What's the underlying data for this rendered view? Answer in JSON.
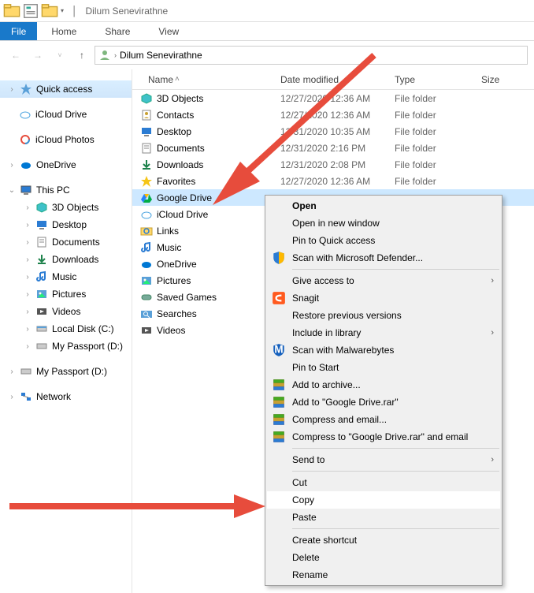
{
  "window": {
    "title": "Dilum Senevirathne"
  },
  "ribbon": {
    "file": "File",
    "tabs": [
      "Home",
      "Share",
      "View"
    ]
  },
  "breadcrumb": {
    "text": "Dilum Senevirathne"
  },
  "columns": {
    "name": "Name",
    "date": "Date modified",
    "type": "Type",
    "size": "Size"
  },
  "sidebar": {
    "quick_access": "Quick access",
    "icloud_drive": "iCloud Drive",
    "icloud_photos": "iCloud Photos",
    "onedrive": "OneDrive",
    "this_pc": "This PC",
    "pc_items": [
      "3D Objects",
      "Desktop",
      "Documents",
      "Downloads",
      "Music",
      "Pictures",
      "Videos",
      "Local Disk (C:)",
      "My Passport (D:)"
    ],
    "my_passport": "My Passport (D:)",
    "network": "Network"
  },
  "files": [
    {
      "name": "3D Objects",
      "date": "12/27/2020 12:36 AM",
      "type": "File folder",
      "icon": "3d"
    },
    {
      "name": "Contacts",
      "date": "12/27/2020 12:36 AM",
      "type": "File folder",
      "icon": "contacts"
    },
    {
      "name": "Desktop",
      "date": "12/31/2020 10:35 AM",
      "type": "File folder",
      "icon": "desktop"
    },
    {
      "name": "Documents",
      "date": "12/31/2020 2:16 PM",
      "type": "File folder",
      "icon": "docs"
    },
    {
      "name": "Downloads",
      "date": "12/31/2020 2:08 PM",
      "type": "File folder",
      "icon": "down"
    },
    {
      "name": "Favorites",
      "date": "12/27/2020 12:36 AM",
      "type": "File folder",
      "icon": "star"
    },
    {
      "name": "Google Drive",
      "date": "",
      "type": "",
      "icon": "gdrive",
      "selected": true
    },
    {
      "name": "iCloud Drive",
      "date": "",
      "type": "",
      "icon": "icloud"
    },
    {
      "name": "Links",
      "date": "",
      "type": "",
      "icon": "links"
    },
    {
      "name": "Music",
      "date": "",
      "type": "",
      "icon": "music"
    },
    {
      "name": "OneDrive",
      "date": "",
      "type": "",
      "icon": "onedrive"
    },
    {
      "name": "Pictures",
      "date": "",
      "type": "",
      "icon": "pics"
    },
    {
      "name": "Saved Games",
      "date": "",
      "type": "",
      "icon": "games"
    },
    {
      "name": "Searches",
      "date": "",
      "type": "",
      "icon": "search"
    },
    {
      "name": "Videos",
      "date": "",
      "type": "",
      "icon": "videos"
    }
  ],
  "context_menu": [
    {
      "label": "Open",
      "bold": true
    },
    {
      "label": "Open in new window"
    },
    {
      "label": "Pin to Quick access"
    },
    {
      "label": "Scan with Microsoft Defender...",
      "icon": "shield"
    },
    {
      "sep": true
    },
    {
      "label": "Give access to",
      "sub": true
    },
    {
      "label": "Snagit",
      "icon": "snagit"
    },
    {
      "label": "Restore previous versions"
    },
    {
      "label": "Include in library",
      "sub": true
    },
    {
      "label": "Scan with Malwarebytes",
      "icon": "mwb"
    },
    {
      "label": "Pin to Start"
    },
    {
      "label": "Add to archive...",
      "icon": "rar"
    },
    {
      "label": "Add to \"Google Drive.rar\"",
      "icon": "rar"
    },
    {
      "label": "Compress and email...",
      "icon": "rar"
    },
    {
      "label": "Compress to \"Google Drive.rar\" and email",
      "icon": "rar"
    },
    {
      "sep": true
    },
    {
      "label": "Send to",
      "sub": true
    },
    {
      "sep": true
    },
    {
      "label": "Cut"
    },
    {
      "label": "Copy",
      "hover": true
    },
    {
      "label": "Paste"
    },
    {
      "sep": true
    },
    {
      "label": "Create shortcut"
    },
    {
      "label": "Delete"
    },
    {
      "label": "Rename"
    }
  ]
}
